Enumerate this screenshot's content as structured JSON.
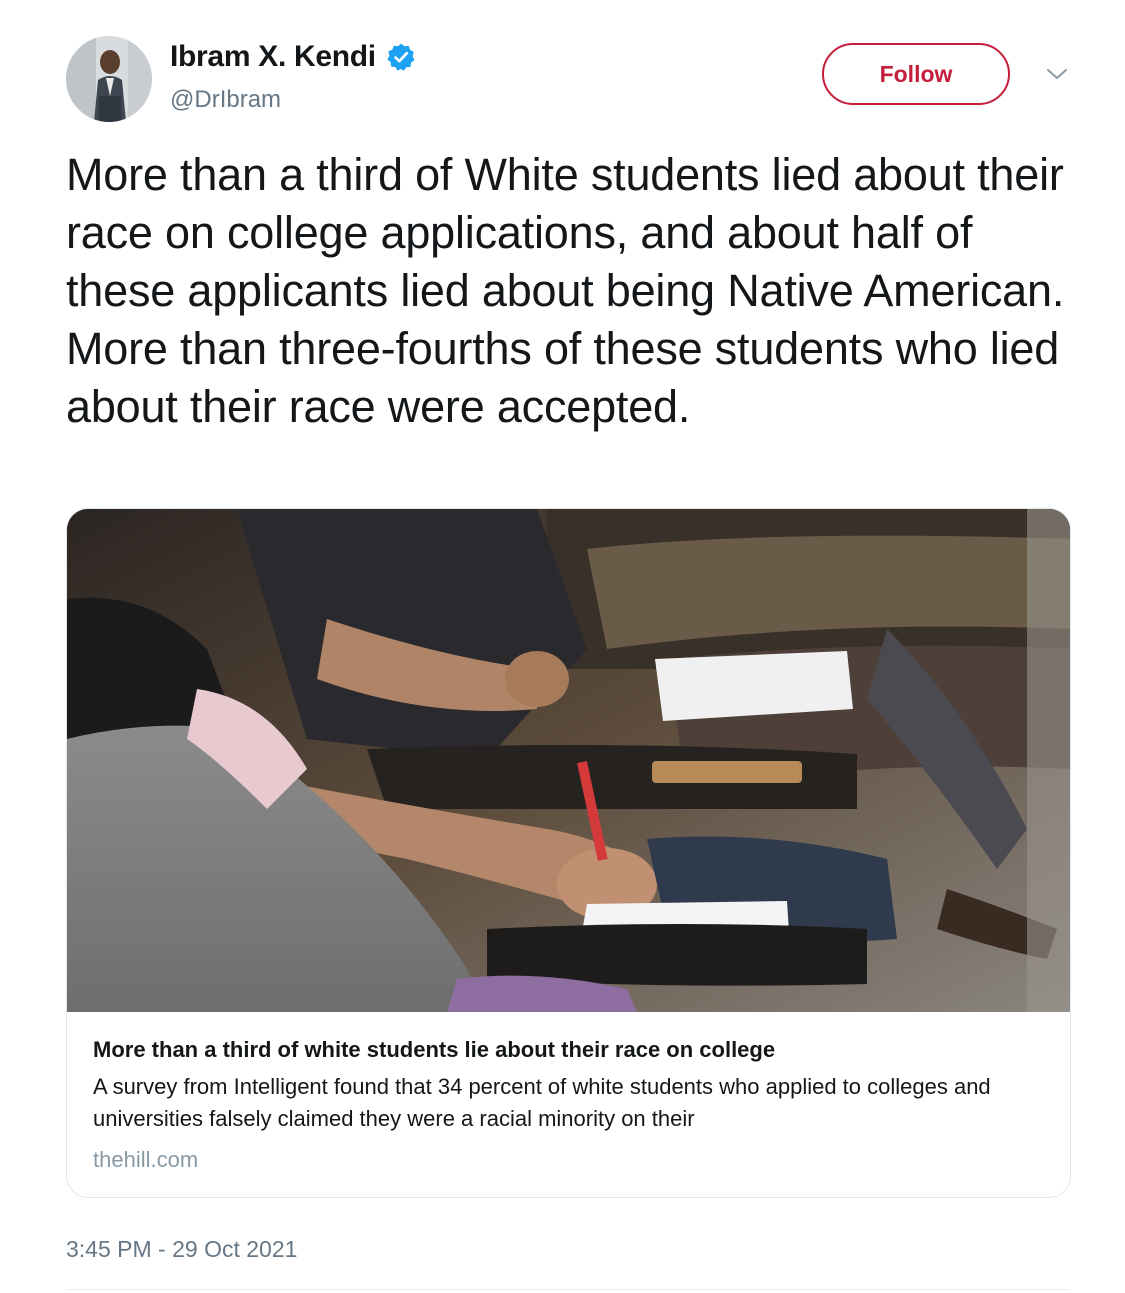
{
  "author": {
    "display_name": "Ibram X. Kendi",
    "handle": "@DrIbram",
    "verified": true
  },
  "actions": {
    "follow_label": "Follow"
  },
  "tweet": {
    "text": "More than a third of White students lied about their race on college applications, and about half of these applicants lied about being Native American. More than three-fourths of these students who lied about their race were accepted.",
    "timestamp": "3:45 PM - 29 Oct 2021"
  },
  "card": {
    "title": "More than a third of white students lie about their race on college",
    "description": " A survey from Intelligent found that 34 percent of white students who applied to colleges and universities falsely claimed they were a racial minority on their",
    "domain": "thehill.com"
  },
  "icons": {
    "verified": "verified-badge-icon",
    "menu": "chevron-down-icon"
  },
  "colors": {
    "accent_red": "#c41e3a",
    "verified_blue": "#1da1f2",
    "secondary_text": "#657786"
  }
}
